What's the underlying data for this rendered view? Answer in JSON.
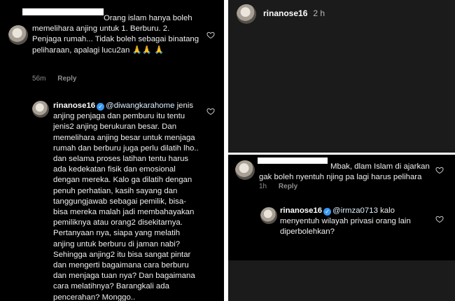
{
  "left": {
    "comment1": {
      "text": "Orang islam hanya boleh memelihara anjing untuk 1. Berburu. 2. Penjaga rumah... Tidak boleh sebagai binatang peliharaan, apalagi lucu2an 🙏🙏 🙏",
      "time": "56m",
      "reply": "Reply"
    },
    "comment2": {
      "username": "rinanose16",
      "mention": "@diwangkarahome",
      "text": "jenis anjing penjaga dan pemburu itu tentu jenis2 anjing berukuran besar. Dan memelihara anjing besar untuk menjaga rumah dan berburu juga perlu dilatih lho.. dan selama proses latihan tentu harus ada kedekatan fisik dan emosional dengan mereka. Kalo ga dilatih dengan penuh perhatian, kasih sayang dan tanggungjawab sebagai pemilik, bisa-bisa mereka malah jadi membahayakan pemiliknya atau orang2 disekitarnya. Pertanyaan nya, siapa yang melatih anjing untuk berburu di jaman nabi? Sehingga anjing2 itu bisa sangat pintar dan mengerti bagaimana cara berburu dan menjaga tuan nya? Dan bagaimana cara melatihnya? Barangkali ada pencerahan? Monggo.."
    }
  },
  "right": {
    "header": {
      "username": "rinanose16",
      "time": "2 h"
    },
    "comment1": {
      "text": "Mbak, dlam Islam di ajarkan gak boleh nyentuh njing pa lagi harus pelihara",
      "time": "1h",
      "reply": "Reply"
    },
    "comment2": {
      "username": "rinanose16",
      "mention": "@irmza0713",
      "text": "kalo menyentuh wilayah privasi orang lain diperbolehkan?"
    }
  },
  "icons": [
    "heart-icon",
    "verified-badge-icon",
    "avatar"
  ],
  "colors": {
    "background": "#000000",
    "panel_gray": "#1b1b1b",
    "verified": "#3897f0",
    "meta": "#8e8e8e"
  }
}
